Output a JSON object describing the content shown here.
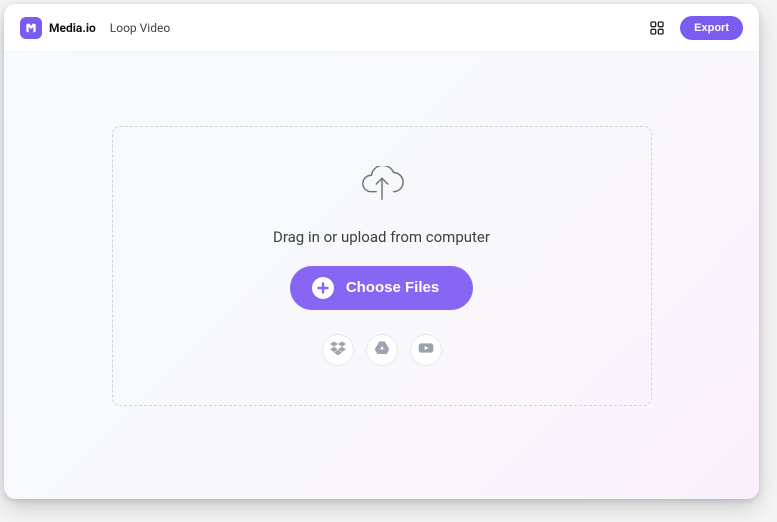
{
  "header": {
    "brand": "Media.io",
    "page_title": "Loop Video",
    "export_label": "Export"
  },
  "dropzone": {
    "instruction": "Drag in or upload from computer",
    "choose_label": "Choose Files",
    "sources": [
      {
        "name": "dropbox"
      },
      {
        "name": "google-drive"
      },
      {
        "name": "youtube"
      }
    ]
  },
  "colors": {
    "accent": "#7b5cf0",
    "accent_soft": "#8666f2"
  }
}
